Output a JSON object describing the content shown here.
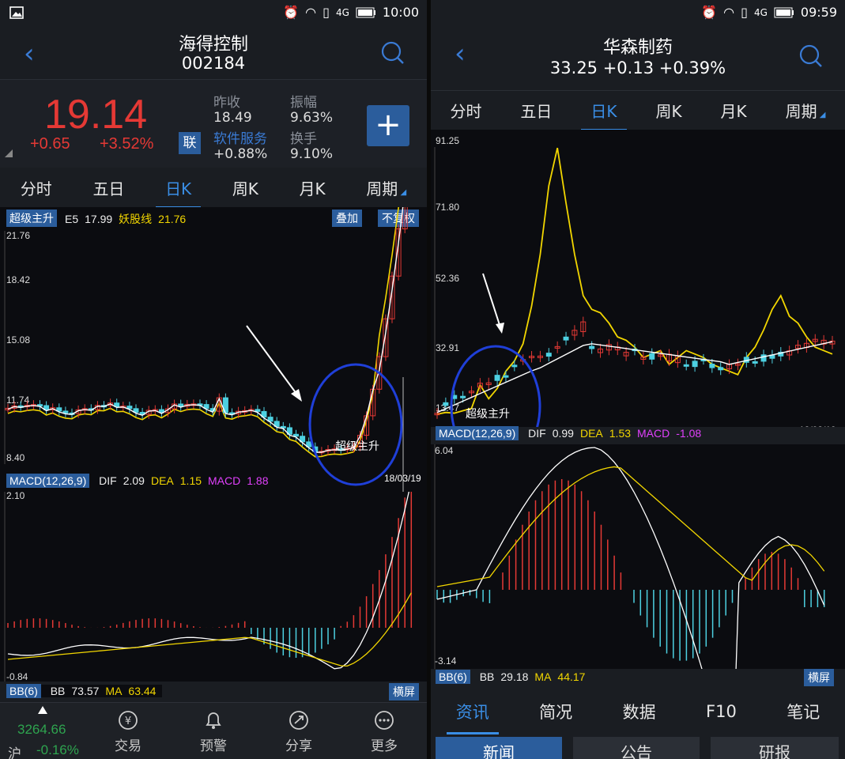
{
  "left": {
    "status_time": "10:00",
    "stock_name": "海得控制",
    "stock_code": "002184",
    "price": "19.14",
    "change": "+0.65",
    "change_pct": "+3.52%",
    "lian_label": "联",
    "prev_close_label": "昨收",
    "prev_close": "18.49",
    "amplitude_label": "振幅",
    "amplitude": "9.63%",
    "sector_name": "软件服务",
    "sector_change": "+0.88%",
    "turnover_label": "换手",
    "turnover": "9.10%",
    "tabs": [
      "分时",
      "五日",
      "日K",
      "周K",
      "月K",
      "周期"
    ],
    "indicator_name": "超级主升",
    "e5_label": "E5",
    "e5_value": "17.99",
    "yao_label": "妖股线",
    "yao_value": "21.76",
    "overlay_btn": "叠加",
    "adjust_btn": "不复权",
    "y_ticks": [
      "21.76",
      "18.42",
      "15.08",
      "11.74",
      "8.40"
    ],
    "annotation": "超级主升",
    "date_label": "18/03/19",
    "macd_name": "MACD(12,26,9)",
    "dif_label": "DIF",
    "dif_value": "2.09",
    "dea_label": "DEA",
    "dea_value": "1.15",
    "macd_label": "MACD",
    "macd_value": "1.88",
    "macd_top": "2.10",
    "macd_bottom": "-0.84",
    "bb_name": "BB(6)",
    "bb_label": "BB",
    "bb_value": "73.57",
    "ma_label": "MA",
    "ma_value": "63.44",
    "landscape_btn": "横屏",
    "index_value": "3264.66",
    "index_name": "沪",
    "index_change": "-0.16%",
    "nav": [
      "交易",
      "预警",
      "分享",
      "更多"
    ]
  },
  "right": {
    "status_time": "09:59",
    "stock_name": "华森制药",
    "quote_line": "33.25 +0.13 +0.39%",
    "tabs": [
      "分时",
      "五日",
      "日K",
      "周K",
      "月K",
      "周期"
    ],
    "y_ticks": [
      "91.25",
      "71.80",
      "52.36",
      "32.91",
      "13.47"
    ],
    "annotation": "超级主升",
    "date_label": "18/03/19",
    "macd_name": "MACD(12,26,9)",
    "dif_label": "DIF",
    "dif_value": "0.99",
    "dea_label": "DEA",
    "dea_value": "1.53",
    "macd_label": "MACD",
    "macd_value": "-1.08",
    "macd_top": "6.04",
    "macd_bottom": "-3.14",
    "bb_name": "BB(6)",
    "bb_label": "BB",
    "bb_value": "29.18",
    "ma_label": "MA",
    "ma_value": "44.17",
    "landscape_btn": "横屏",
    "info_tabs": [
      "资讯",
      "简况",
      "数据",
      "F10",
      "笔记"
    ],
    "sub_tabs": [
      "新闻",
      "公告",
      "研报"
    ]
  },
  "colors": {
    "up": "#e53935",
    "down": "#4dd0e1",
    "accent": "#3a8ee6",
    "yellow": "#f2d600",
    "bg": "#0b0c10"
  }
}
